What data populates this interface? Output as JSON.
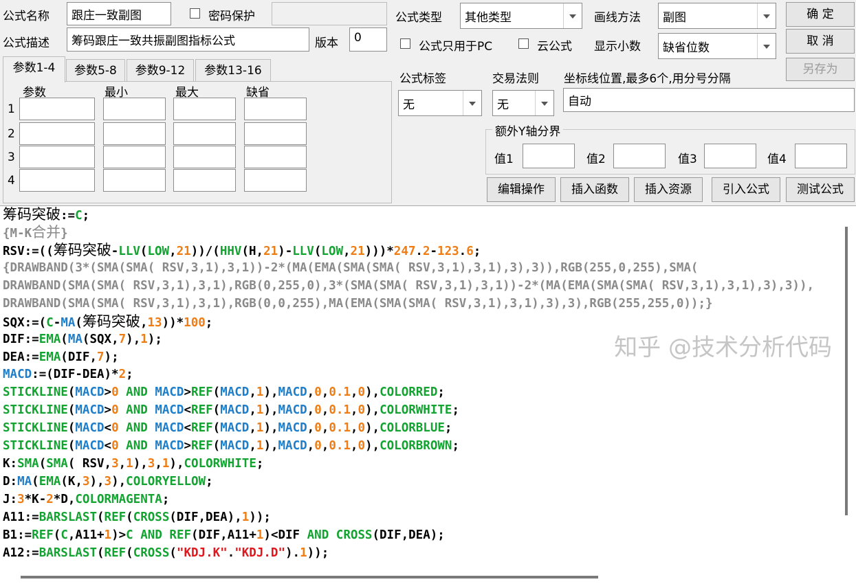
{
  "header": {
    "name_label": "公式名称",
    "name_value": "跟庄一致副图",
    "password_label": "密码保护",
    "desc_label": "公式描述",
    "desc_value": "筹码跟庄一致共振副图指标公式",
    "version_label": "版本",
    "version_value": "0",
    "type_label": "公式类型",
    "type_value": "其他类型",
    "draw_label": "画线方法",
    "draw_value": "副图",
    "pc_only_label": "公式只用于PC",
    "cloud_label": "云公式",
    "decimal_label": "显示小数",
    "decimal_value": "缺省位数"
  },
  "buttons": {
    "ok": "确 定",
    "cancel": "取 消",
    "save_as": "另存为",
    "edit_ops": "编辑操作",
    "insert_func": "插入函数",
    "insert_res": "插入资源",
    "import_formula": "引入公式",
    "test_formula": "测试公式"
  },
  "tabs": [
    "参数1-4",
    "参数5-8",
    "参数9-12",
    "参数13-16"
  ],
  "params": {
    "headers": [
      "参数",
      "最小",
      "最大",
      "缺省"
    ],
    "rows": [
      "1",
      "2",
      "3",
      "4"
    ]
  },
  "options": {
    "tag_label": "公式标签",
    "tag_value": "无",
    "rule_label": "交易法则",
    "rule_value": "无",
    "coord_label": "坐标线位置,最多6个,用分号分隔",
    "coord_value": "自动"
  },
  "yaxis": {
    "title": "额外Y轴分界",
    "labels": [
      "值1",
      "值2",
      "值3",
      "值4"
    ]
  },
  "code_lines": [
    [
      [
        "筹码突破",
        "cn"
      ],
      [
        ":=",
        ""
      ],
      [
        "C",
        "fn"
      ],
      [
        ";",
        ""
      ]
    ],
    [
      [
        "{M-K",
        "cmt"
      ],
      [
        "合并",
        "cmt cn"
      ],
      [
        "}",
        "cmt"
      ]
    ],
    [
      [
        "RSV:=((",
        ""
      ],
      [
        "筹码突破",
        "cn"
      ],
      [
        "-",
        ""
      ],
      [
        "LLV",
        "fn"
      ],
      [
        "(",
        ""
      ],
      [
        "LOW",
        "fn"
      ],
      [
        ",",
        ""
      ],
      [
        "21",
        "num"
      ],
      [
        "))/(",
        ""
      ],
      [
        "HHV",
        "fn"
      ],
      [
        "(H,",
        ""
      ],
      [
        "21",
        "num"
      ],
      [
        ")-",
        ""
      ],
      [
        "LLV",
        "fn"
      ],
      [
        "(",
        ""
      ],
      [
        "LOW",
        "fn"
      ],
      [
        ",",
        ""
      ],
      [
        "21",
        "num"
      ],
      [
        ")))*",
        ""
      ],
      [
        "247",
        "num"
      ],
      [
        ".",
        ""
      ],
      [
        "2",
        "num"
      ],
      [
        "-",
        ""
      ],
      [
        "123",
        "num"
      ],
      [
        ".",
        ""
      ],
      [
        "6",
        "num"
      ],
      [
        ";",
        ""
      ]
    ],
    [
      [
        "{DRAWBAND(3*(SMA(SMA( RSV,3,1),3,1))-2*(MA(EMA(SMA(SMA( RSV,3,1),3,1),3),3)),RGB(255,0,255),SMA(",
        "cmt"
      ]
    ],
    [
      [
        "DRAWBAND(SMA(SMA( RSV,3,1),3,1),RGB(0,255,0),3*(SMA(SMA( RSV,3,1),3,1))-2*(MA(EMA(SMA(SMA( RSV,3,1),3,1),3),3)),",
        "cmt"
      ]
    ],
    [
      [
        "DRAWBAND(SMA(SMA( RSV,3,1),3,1),RGB(0,0,255),MA(EMA(SMA(SMA( RSV,3,1),3,1),3),3),RGB(255,255,0));}",
        "cmt"
      ]
    ],
    [
      [
        "SQX:=(",
        ""
      ],
      [
        "C",
        "fn"
      ],
      [
        "-",
        ""
      ],
      [
        "MA",
        "ind"
      ],
      [
        "(",
        ""
      ],
      [
        "筹码突破",
        "cn"
      ],
      [
        ",",
        ""
      ],
      [
        "13",
        "num"
      ],
      [
        "))*",
        ""
      ],
      [
        "100",
        "num"
      ],
      [
        ";",
        ""
      ]
    ],
    [
      [
        "DIF:=",
        ""
      ],
      [
        "EMA",
        "fn"
      ],
      [
        "(",
        ""
      ],
      [
        "MA",
        "ind"
      ],
      [
        "(SQX,",
        ""
      ],
      [
        "7",
        "num"
      ],
      [
        "),",
        ""
      ],
      [
        "1",
        "num"
      ],
      [
        ");",
        ""
      ]
    ],
    [
      [
        "DEA:=",
        ""
      ],
      [
        "EMA",
        "fn"
      ],
      [
        "(DIF,",
        ""
      ],
      [
        "7",
        "num"
      ],
      [
        ");",
        ""
      ]
    ],
    [
      [
        "MACD",
        "ind"
      ],
      [
        ":=(DIF-DEA)*",
        ""
      ],
      [
        "2",
        "num"
      ],
      [
        ";",
        ""
      ]
    ],
    [
      [
        "STICKLINE",
        "fn"
      ],
      [
        "(",
        ""
      ],
      [
        "MACD",
        "ind"
      ],
      [
        ">",
        ""
      ],
      [
        "0",
        "num"
      ],
      [
        " ",
        ""
      ],
      [
        "AND",
        "fn"
      ],
      [
        " ",
        ""
      ],
      [
        "MACD",
        "ind"
      ],
      [
        ">",
        ""
      ],
      [
        "REF",
        "fn"
      ],
      [
        "(",
        ""
      ],
      [
        "MACD",
        "ind"
      ],
      [
        ",",
        ""
      ],
      [
        "1",
        "num"
      ],
      [
        "),",
        ""
      ],
      [
        "MACD",
        "ind"
      ],
      [
        ",",
        ""
      ],
      [
        "0",
        "num"
      ],
      [
        ",",
        ""
      ],
      [
        "0.1",
        "num"
      ],
      [
        ",",
        ""
      ],
      [
        "0",
        "num"
      ],
      [
        "),",
        ""
      ],
      [
        "COLORRED",
        "fn"
      ],
      [
        ";",
        ""
      ]
    ],
    [
      [
        "STICKLINE",
        "fn"
      ],
      [
        "(",
        ""
      ],
      [
        "MACD",
        "ind"
      ],
      [
        ">",
        ""
      ],
      [
        "0",
        "num"
      ],
      [
        " ",
        ""
      ],
      [
        "AND",
        "fn"
      ],
      [
        " ",
        ""
      ],
      [
        "MACD",
        "ind"
      ],
      [
        "<",
        ""
      ],
      [
        "REF",
        "fn"
      ],
      [
        "(",
        ""
      ],
      [
        "MACD",
        "ind"
      ],
      [
        ",",
        ""
      ],
      [
        "1",
        "num"
      ],
      [
        "),",
        ""
      ],
      [
        "MACD",
        "ind"
      ],
      [
        ",",
        ""
      ],
      [
        "0",
        "num"
      ],
      [
        ",",
        ""
      ],
      [
        "0.1",
        "num"
      ],
      [
        ",",
        ""
      ],
      [
        "0",
        "num"
      ],
      [
        "),",
        ""
      ],
      [
        "COLORWHITE",
        "fn"
      ],
      [
        ";",
        ""
      ]
    ],
    [
      [
        "STICKLINE",
        "fn"
      ],
      [
        "(",
        ""
      ],
      [
        "MACD",
        "ind"
      ],
      [
        "<",
        ""
      ],
      [
        "0",
        "num"
      ],
      [
        " ",
        ""
      ],
      [
        "AND",
        "fn"
      ],
      [
        " ",
        ""
      ],
      [
        "MACD",
        "ind"
      ],
      [
        "<",
        ""
      ],
      [
        "REF",
        "fn"
      ],
      [
        "(",
        ""
      ],
      [
        "MACD",
        "ind"
      ],
      [
        ",",
        ""
      ],
      [
        "1",
        "num"
      ],
      [
        "),",
        ""
      ],
      [
        "MACD",
        "ind"
      ],
      [
        ",",
        ""
      ],
      [
        "0",
        "num"
      ],
      [
        ",",
        ""
      ],
      [
        "0.1",
        "num"
      ],
      [
        ",",
        ""
      ],
      [
        "0",
        "num"
      ],
      [
        "),",
        ""
      ],
      [
        "COLORBLUE",
        "fn"
      ],
      [
        ";",
        ""
      ]
    ],
    [
      [
        "STICKLINE",
        "fn"
      ],
      [
        "(",
        ""
      ],
      [
        "MACD",
        "ind"
      ],
      [
        "<",
        ""
      ],
      [
        "0",
        "num"
      ],
      [
        " ",
        ""
      ],
      [
        "AND",
        "fn"
      ],
      [
        " ",
        ""
      ],
      [
        "MACD",
        "ind"
      ],
      [
        ">",
        ""
      ],
      [
        "REF",
        "fn"
      ],
      [
        "(",
        ""
      ],
      [
        "MACD",
        "ind"
      ],
      [
        ",",
        ""
      ],
      [
        "1",
        "num"
      ],
      [
        "),",
        ""
      ],
      [
        "MACD",
        "ind"
      ],
      [
        ",",
        ""
      ],
      [
        "0",
        "num"
      ],
      [
        ",",
        ""
      ],
      [
        "0.1",
        "num"
      ],
      [
        ",",
        ""
      ],
      [
        "0",
        "num"
      ],
      [
        "),",
        ""
      ],
      [
        "COLORBROWN",
        "fn"
      ],
      [
        ";",
        ""
      ]
    ],
    [
      [
        "K:",
        ""
      ],
      [
        "SMA",
        "fn"
      ],
      [
        "(",
        ""
      ],
      [
        "SMA",
        "fn"
      ],
      [
        "( RSV,",
        ""
      ],
      [
        "3",
        "num"
      ],
      [
        ",",
        ""
      ],
      [
        "1",
        "num"
      ],
      [
        "),",
        ""
      ],
      [
        "3",
        "num"
      ],
      [
        ",",
        ""
      ],
      [
        "1",
        "num"
      ],
      [
        "),",
        ""
      ],
      [
        "COLORWHITE",
        "fn"
      ],
      [
        ";",
        ""
      ]
    ],
    [
      [
        "D:",
        ""
      ],
      [
        "MA",
        "ind"
      ],
      [
        "(",
        ""
      ],
      [
        "EMA",
        "fn"
      ],
      [
        "(K,",
        ""
      ],
      [
        "3",
        "num"
      ],
      [
        "),",
        ""
      ],
      [
        "3",
        "num"
      ],
      [
        "),",
        ""
      ],
      [
        "COLORYELLOW",
        "fn"
      ],
      [
        ";",
        ""
      ]
    ],
    [
      [
        "J:",
        ""
      ],
      [
        "3",
        "num"
      ],
      [
        "*K-",
        ""
      ],
      [
        "2",
        "num"
      ],
      [
        "*D,",
        ""
      ],
      [
        "COLORMAGENTA",
        "fn"
      ],
      [
        ";",
        ""
      ]
    ],
    [
      [
        "A11:=",
        ""
      ],
      [
        "BARSLAST",
        "fn"
      ],
      [
        "(",
        ""
      ],
      [
        "REF",
        "fn"
      ],
      [
        "(",
        ""
      ],
      [
        "CROSS",
        "fn"
      ],
      [
        "(DIF,DEA),",
        ""
      ],
      [
        "1",
        "num"
      ],
      [
        "));",
        ""
      ]
    ],
    [
      [
        "B1:=",
        ""
      ],
      [
        "REF",
        "fn"
      ],
      [
        "(",
        ""
      ],
      [
        "C",
        "fn"
      ],
      [
        ",A11+",
        ""
      ],
      [
        "1",
        "num"
      ],
      [
        ")>",
        ""
      ],
      [
        "C",
        "fn"
      ],
      [
        " ",
        ""
      ],
      [
        "AND",
        "fn"
      ],
      [
        " ",
        ""
      ],
      [
        "REF",
        "fn"
      ],
      [
        "(DIF,A11+",
        ""
      ],
      [
        "1",
        "num"
      ],
      [
        ")<DIF ",
        ""
      ],
      [
        "AND",
        "fn"
      ],
      [
        " ",
        ""
      ],
      [
        "CROSS",
        "fn"
      ],
      [
        "(DIF,DEA);",
        ""
      ]
    ],
    [
      [
        "A12:=",
        ""
      ],
      [
        "BARSLAST",
        "fn"
      ],
      [
        "(",
        ""
      ],
      [
        "REF",
        "fn"
      ],
      [
        "(",
        ""
      ],
      [
        "CROSS",
        "fn"
      ],
      [
        "(",
        ""
      ],
      [
        "\"KDJ.K\"",
        "str"
      ],
      [
        ".",
        ""
      ],
      [
        "\"KDJ.D\"",
        "str"
      ],
      [
        ").",
        ""
      ],
      [
        "1",
        "num"
      ],
      [
        "));",
        ""
      ]
    ]
  ],
  "watermark": "知乎 @技术分析代码"
}
